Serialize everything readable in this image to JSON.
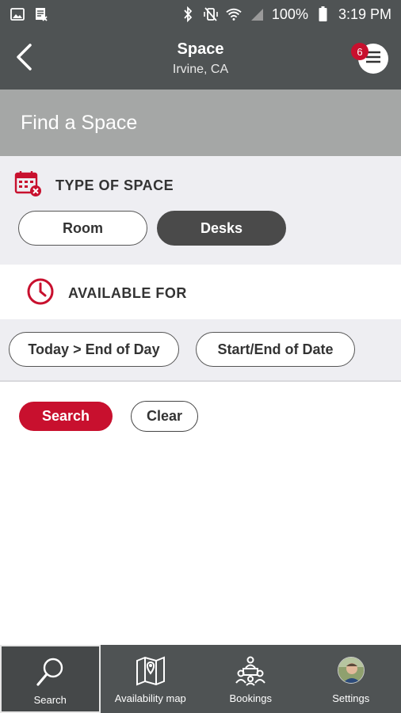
{
  "status_bar": {
    "battery": "100%",
    "time": "3:19 PM"
  },
  "header": {
    "title": "Space",
    "subtitle": "Irvine, CA",
    "menu_badge": "6"
  },
  "find_space": {
    "title": "Find a Space"
  },
  "type_of_space": {
    "label": "TYPE OF SPACE",
    "options": [
      "Room",
      "Desks"
    ],
    "selected": "Desks"
  },
  "available_for": {
    "label": "AVAILABLE FOR",
    "options": [
      "Today > End of Day",
      "Start/End of Date"
    ]
  },
  "actions": {
    "search_label": "Search",
    "clear_label": "Clear"
  },
  "bottom_nav": {
    "items": [
      "Search",
      "Availability map",
      "Bookings",
      "Settings"
    ],
    "active": "Search"
  },
  "colors": {
    "accent": "#c8102e",
    "header_bg": "#4f5354",
    "band_bg": "#a5a7a6"
  }
}
